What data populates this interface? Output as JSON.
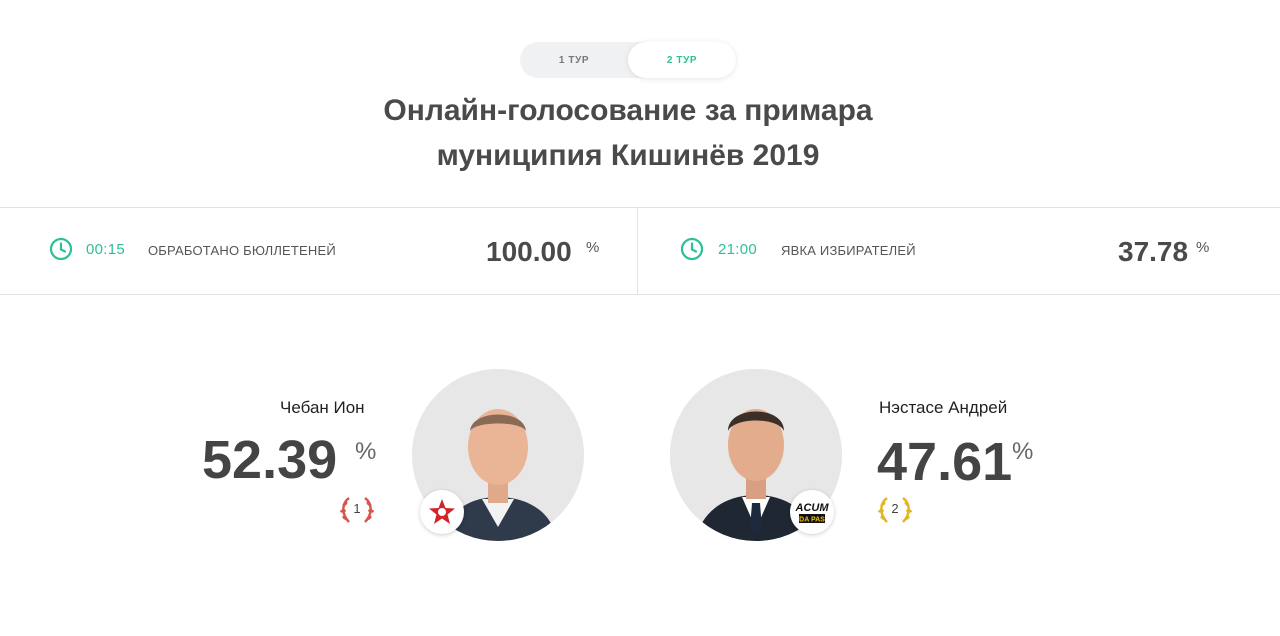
{
  "tabs": [
    {
      "label": "1 ТУР",
      "active": false
    },
    {
      "label": "2 ТУР",
      "active": true
    }
  ],
  "title": {
    "line1": "Онлайн-голосование за примара",
    "line2": "муниципия Кишинёв 2019"
  },
  "stats": {
    "processed": {
      "time": "00:15",
      "label": "ОБРАБОТАНО БЮЛЛЕТЕНЕЙ",
      "value": "100.00",
      "unit": "%"
    },
    "turnout": {
      "time": "21:00",
      "label": "ЯВКА ИЗБИРАТЕЛЕЙ",
      "value": "37.78",
      "unit": "%"
    }
  },
  "candidates": [
    {
      "name": "Чебан Ион",
      "value": "52.39",
      "unit": "%",
      "rank": "1",
      "party_icon": "red-star-icon",
      "rank_color": "#d9534f"
    },
    {
      "name": "Нэстасе Андрей",
      "value": "47.61",
      "unit": "%",
      "rank": "2",
      "party_icon": "acum-logo",
      "party_text": "ACUM",
      "party_subtext": "DA PAS",
      "rank_color": "#e5b425"
    }
  ],
  "colors": {
    "accent": "#2dbf98",
    "winner_laurel": "#d9534f",
    "second_laurel": "#e5b425"
  }
}
